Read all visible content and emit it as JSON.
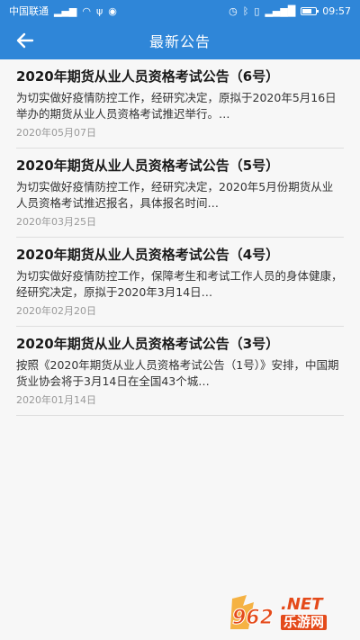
{
  "status_bar": {
    "carrier": "中国联通",
    "time": "09:57",
    "battery_level": 0.7
  },
  "header": {
    "title": "最新公告",
    "back_icon": "back-arrow-icon"
  },
  "announcements": [
    {
      "title": "2020年期货从业人员资格考试公告（6号）",
      "summary": "为切实做好疫情防控工作，经研究决定，原拟于2020年5月16日举办的期货从业人员资格考试推迟举行。…",
      "date": "2020年05月07日"
    },
    {
      "title": "2020年期货从业人员资格考试公告（5号）",
      "summary": "为切实做好疫情防控工作，经研究决定，2020年5月份期货从业人员资格考试推迟报名，具体报名时间…",
      "date": "2020年03月25日"
    },
    {
      "title": "2020年期货从业人员资格考试公告（4号）",
      "summary": "为切实做好疫情防控工作，保障考生和考试工作人员的身体健康，经研究决定，原拟于2020年3月14日…",
      "date": "2020年02月20日"
    },
    {
      "title": "2020年期货从业人员资格考试公告（3号）",
      "summary": "按照《2020年期货从业人员资格考试公告（1号）》安排，中国期货业协会将于3月14日在全国43个城…",
      "date": "2020年01月14日"
    }
  ],
  "watermark": {
    "logo_text": "962",
    "domain": ".NET",
    "site_name": "乐游网"
  },
  "colors": {
    "primary": "#2f86d8",
    "background": "#f7f7f7",
    "watermark_accent": "#e44a1a"
  }
}
